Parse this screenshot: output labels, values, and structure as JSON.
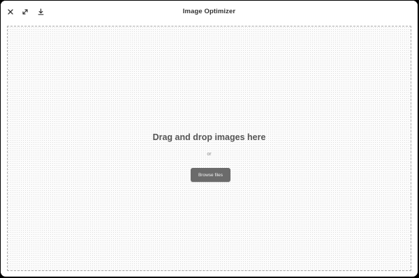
{
  "window": {
    "title": "Image Optimizer"
  },
  "toolbar": {
    "buttons": [
      {
        "icon": "close-icon"
      },
      {
        "icon": "expand-icon"
      },
      {
        "icon": "download-icon"
      }
    ]
  },
  "dropzone": {
    "heading": "Drag and drop images here",
    "separator": "or",
    "browse_label": "Browse files"
  },
  "colors": {
    "button_bg": "#6b6b6b",
    "dropzone_border": "#a8a8a8"
  }
}
